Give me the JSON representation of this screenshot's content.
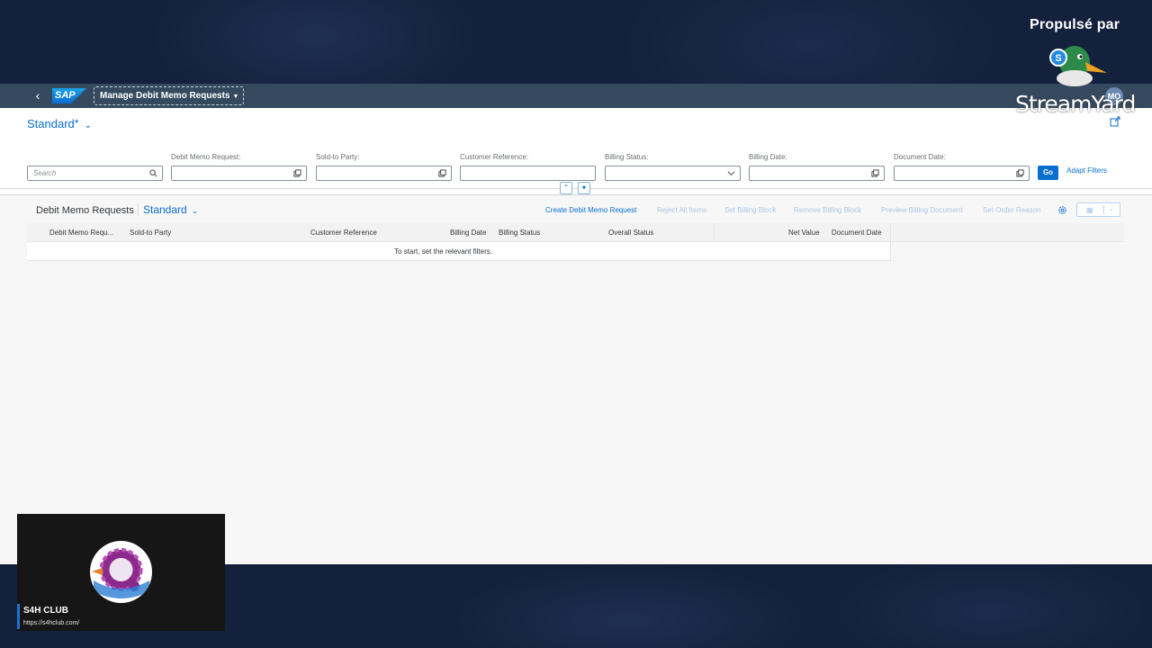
{
  "overlay": {
    "propulse": "Propulsé par",
    "brand": "StreamYard"
  },
  "shell": {
    "app_title": "Manage Debit Memo Requests",
    "sap_logo": "SAP",
    "avatar": "MO"
  },
  "header": {
    "variant": "Standard",
    "variant_modified": "*",
    "search_placeholder": "Search",
    "filters": [
      {
        "label": "Debit Memo Request:",
        "value": ""
      },
      {
        "label": "Sold-to Party:",
        "value": ""
      },
      {
        "label": "Customer Reference:",
        "value": ""
      },
      {
        "label": "Billing Status:",
        "value": ""
      },
      {
        "label": "Billing Date:",
        "value": ""
      },
      {
        "label": "Document Date:",
        "value": ""
      }
    ],
    "go": "Go",
    "adapt_filters": "Adapt Filters"
  },
  "table": {
    "title": "Debit Memo Requests",
    "variant": "Standard",
    "actions": [
      {
        "label": "Create Debit Memo Request",
        "enabled": true
      },
      {
        "label": "Reject All Items",
        "enabled": false
      },
      {
        "label": "Set Billing Block",
        "enabled": false
      },
      {
        "label": "Remove Billing Block",
        "enabled": false
      },
      {
        "label": "Preview Billing Document",
        "enabled": false
      },
      {
        "label": "Set Order Reason",
        "enabled": false
      }
    ],
    "columns": [
      "Debit Memo Requ...",
      "Sold-to Party",
      "Customer Reference",
      "Billing Date",
      "Billing Status",
      "Overall Status",
      "Net Value",
      "Document Date"
    ],
    "empty_message": "To start, set the relevant filters."
  },
  "tile": {
    "name": "S4H CLUB",
    "url": "https://s4hclub.com/"
  },
  "colors": {
    "accent": "#0a6ed1",
    "shellbar": "#354a5f",
    "stream_bg": "#14213d"
  }
}
